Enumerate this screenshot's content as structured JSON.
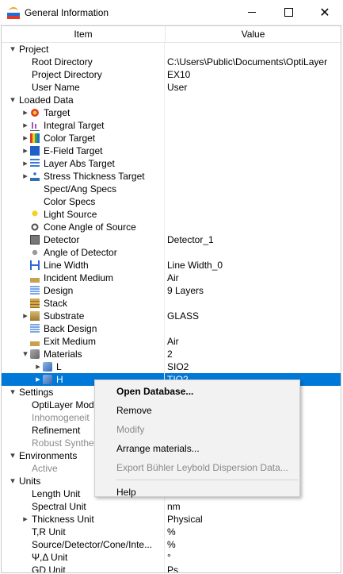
{
  "window": {
    "title": "General Information",
    "icon": "optilayer-app-icon"
  },
  "columns": {
    "item": "Item",
    "value": "Value"
  },
  "rows": [
    {
      "id": "project",
      "label": "Project",
      "value": "",
      "level": 0,
      "exp": "open",
      "icon": ""
    },
    {
      "id": "root-dir",
      "label": "Root Directory",
      "value": "C:\\Users\\Public\\Documents\\OptiLayer",
      "level": 1,
      "exp": "",
      "icon": ""
    },
    {
      "id": "project-dir",
      "label": "Project Directory",
      "value": "EX10",
      "level": 1,
      "exp": "",
      "icon": ""
    },
    {
      "id": "user-name",
      "label": "User Name",
      "value": "User",
      "level": 1,
      "exp": "",
      "icon": ""
    },
    {
      "id": "loaded-data",
      "label": "Loaded Data",
      "value": "",
      "level": 0,
      "exp": "open",
      "icon": ""
    },
    {
      "id": "target",
      "label": "Target",
      "value": "",
      "level": 1,
      "exp": "closed",
      "icon": "target"
    },
    {
      "id": "integral-target",
      "label": "Integral Target",
      "value": "",
      "level": 1,
      "exp": "closed",
      "icon": "integral"
    },
    {
      "id": "color-target",
      "label": "Color Target",
      "value": "",
      "level": 1,
      "exp": "closed",
      "icon": "color"
    },
    {
      "id": "efield-target",
      "label": "E-Field Target",
      "value": "",
      "level": 1,
      "exp": "closed",
      "icon": "efield"
    },
    {
      "id": "layer-abs-target",
      "label": "Layer Abs Target",
      "value": "",
      "level": 1,
      "exp": "closed",
      "icon": "layerabs"
    },
    {
      "id": "stress-thickness-target",
      "label": "Stress Thickness Target",
      "value": "",
      "level": 1,
      "exp": "closed",
      "icon": "stress"
    },
    {
      "id": "spect-ang-specs",
      "label": "Spect/Ang Specs",
      "value": "",
      "level": 1,
      "exp": "",
      "icon": "none"
    },
    {
      "id": "color-specs",
      "label": "Color Specs",
      "value": "",
      "level": 1,
      "exp": "",
      "icon": "none"
    },
    {
      "id": "light-source",
      "label": "Light Source",
      "value": "",
      "level": 1,
      "exp": "",
      "icon": "bulb"
    },
    {
      "id": "cone-angle",
      "label": "Cone Angle of Source",
      "value": "",
      "level": 1,
      "exp": "",
      "icon": "cone"
    },
    {
      "id": "detector",
      "label": "Detector",
      "value": "Detector_1",
      "level": 1,
      "exp": "",
      "icon": "detector"
    },
    {
      "id": "angle-detector",
      "label": "Angle of Detector",
      "value": "",
      "level": 1,
      "exp": "",
      "icon": "angle"
    },
    {
      "id": "line-width",
      "label": "Line Width",
      "value": "Line Width_0",
      "level": 1,
      "exp": "",
      "icon": "width"
    },
    {
      "id": "incident-medium",
      "label": "Incident Medium",
      "value": "Air",
      "level": 1,
      "exp": "",
      "icon": "medium"
    },
    {
      "id": "design",
      "label": "Design",
      "value": "9 Layers",
      "level": 1,
      "exp": "",
      "icon": "design"
    },
    {
      "id": "stack",
      "label": "Stack",
      "value": "",
      "level": 1,
      "exp": "",
      "icon": "stack"
    },
    {
      "id": "substrate",
      "label": "Substrate",
      "value": "GLASS",
      "level": 1,
      "exp": "closed",
      "icon": "substrate"
    },
    {
      "id": "back-design",
      "label": "Back Design",
      "value": "",
      "level": 1,
      "exp": "",
      "icon": "design"
    },
    {
      "id": "exit-medium",
      "label": "Exit Medium",
      "value": "Air",
      "level": 1,
      "exp": "",
      "icon": "medium"
    },
    {
      "id": "materials",
      "label": "Materials",
      "value": "2",
      "level": 1,
      "exp": "open",
      "icon": "materials"
    },
    {
      "id": "mat-l",
      "label": "L",
      "value": "SIO2",
      "level": 2,
      "exp": "closed",
      "icon": "mat"
    },
    {
      "id": "mat-h",
      "label": "H",
      "value": "TIO2",
      "level": 2,
      "exp": "closed",
      "icon": "mat",
      "selected": true
    },
    {
      "id": "settings",
      "label": "Settings",
      "value": "",
      "level": 0,
      "exp": "open",
      "icon": ""
    },
    {
      "id": "optilayer-mode",
      "label": "OptiLayer Mod",
      "value": "",
      "level": 1,
      "exp": "",
      "icon": ""
    },
    {
      "id": "inhomogeneity",
      "label": "Inhomogeneit",
      "value": "",
      "level": 1,
      "exp": "",
      "icon": "",
      "disabled": true
    },
    {
      "id": "refinement",
      "label": "Refinement",
      "value": "",
      "level": 1,
      "exp": "",
      "icon": ""
    },
    {
      "id": "robust-synthesis",
      "label": "Robust Synthe",
      "value": "",
      "level": 1,
      "exp": "",
      "icon": "",
      "disabled": true
    },
    {
      "id": "environments",
      "label": "Environments",
      "value": "",
      "level": 0,
      "exp": "open",
      "icon": ""
    },
    {
      "id": "active",
      "label": "Active",
      "value": "",
      "level": 1,
      "exp": "",
      "icon": "",
      "disabled": true
    },
    {
      "id": "units",
      "label": "Units",
      "value": "",
      "level": 0,
      "exp": "open",
      "icon": ""
    },
    {
      "id": "length-unit",
      "label": "Length Unit",
      "value": "",
      "level": 1,
      "exp": "",
      "icon": ""
    },
    {
      "id": "spectral-unit",
      "label": "Spectral Unit",
      "value": "nm",
      "level": 1,
      "exp": "",
      "icon": ""
    },
    {
      "id": "thickness-unit",
      "label": "Thickness Unit",
      "value": "Physical",
      "level": 1,
      "exp": "closed",
      "icon": ""
    },
    {
      "id": "tr-unit",
      "label": "T,R Unit",
      "value": "%",
      "level": 1,
      "exp": "",
      "icon": ""
    },
    {
      "id": "sdci-unit",
      "label": "Source/Detector/Cone/Inte...",
      "value": "%",
      "level": 1,
      "exp": "",
      "icon": ""
    },
    {
      "id": "psi-delta-unit",
      "label": "Ψ,Δ Unit",
      "value": "°",
      "level": 1,
      "exp": "",
      "icon": ""
    },
    {
      "id": "gd-unit",
      "label": "GD Unit",
      "value": "Ps",
      "level": 1,
      "exp": "",
      "icon": ""
    }
  ],
  "context_menu": [
    {
      "id": "open-database",
      "label": "Open Database...",
      "bold": true,
      "disabled": false
    },
    {
      "id": "remove",
      "label": "Remove",
      "bold": false,
      "disabled": false
    },
    {
      "id": "modify",
      "label": "Modify",
      "bold": false,
      "disabled": true
    },
    {
      "id": "arrange-materials",
      "label": "Arrange materials...",
      "bold": false,
      "disabled": false
    },
    {
      "id": "export-buhler",
      "label": "Export Bühler Leybold Dispersion Data...",
      "bold": false,
      "disabled": true
    },
    {
      "sep": true
    },
    {
      "id": "help",
      "label": "Help",
      "bold": false,
      "disabled": false
    }
  ]
}
